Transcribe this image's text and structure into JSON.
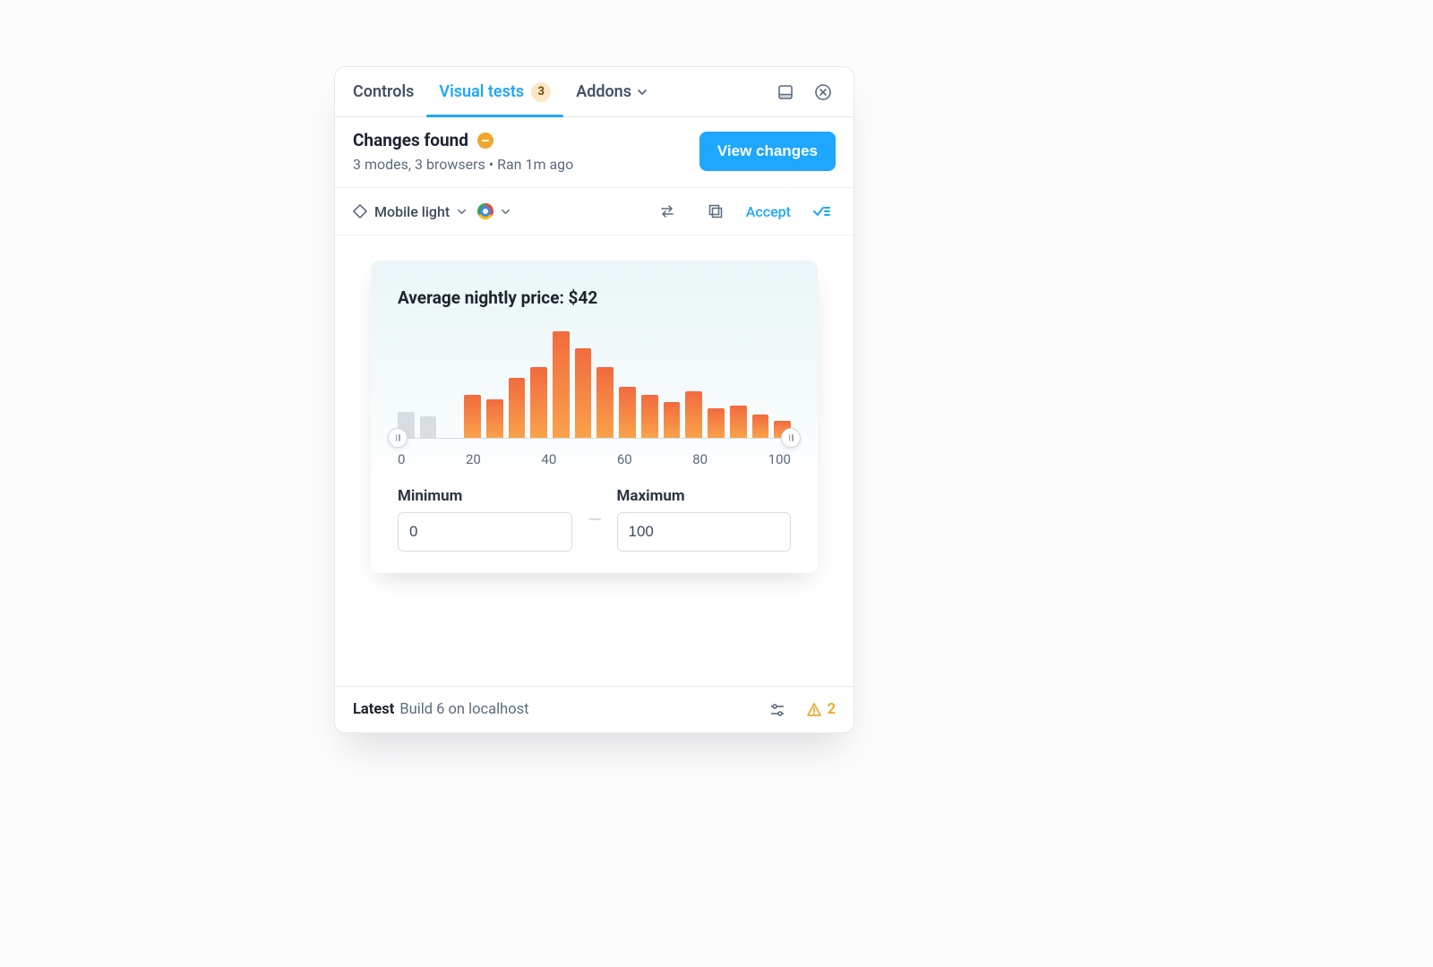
{
  "tabs": {
    "controls": "Controls",
    "visual_tests": "Visual tests",
    "visual_tests_badge": "3",
    "addons": "Addons"
  },
  "header": {
    "title": "Changes found",
    "subtitle": "3 modes, 3 browsers • Ran 1m ago",
    "primary_button": "View changes"
  },
  "toolbar": {
    "mode_label": "Mobile light",
    "accept_label": "Accept"
  },
  "footer": {
    "latest_label": "Latest",
    "build_text": "Build 6 on localhost",
    "warning_count": "2"
  },
  "price_card": {
    "title_prefix": "Average nightly price: ",
    "title_value": "$42",
    "min_label": "Minimum",
    "max_label": "Maximum",
    "min_value": "0",
    "max_value": "100",
    "ticks": [
      "0",
      "20",
      "40",
      "60",
      "80",
      "100"
    ]
  },
  "chart_data": {
    "type": "bar",
    "title": "Average nightly price: $42",
    "xlabel": "",
    "ylabel": "",
    "x": [
      0,
      6,
      12,
      18,
      24,
      29,
      35,
      41,
      47,
      53,
      59,
      65,
      71,
      76,
      82,
      88,
      94,
      100
    ],
    "values_pct": [
      24,
      20,
      0,
      40,
      36,
      56,
      66,
      100,
      84,
      66,
      48,
      40,
      34,
      44,
      28,
      30,
      22,
      16
    ],
    "selected_range": [
      0,
      100
    ],
    "muted_indices": [
      0,
      1
    ],
    "xlim": [
      0,
      100
    ]
  }
}
